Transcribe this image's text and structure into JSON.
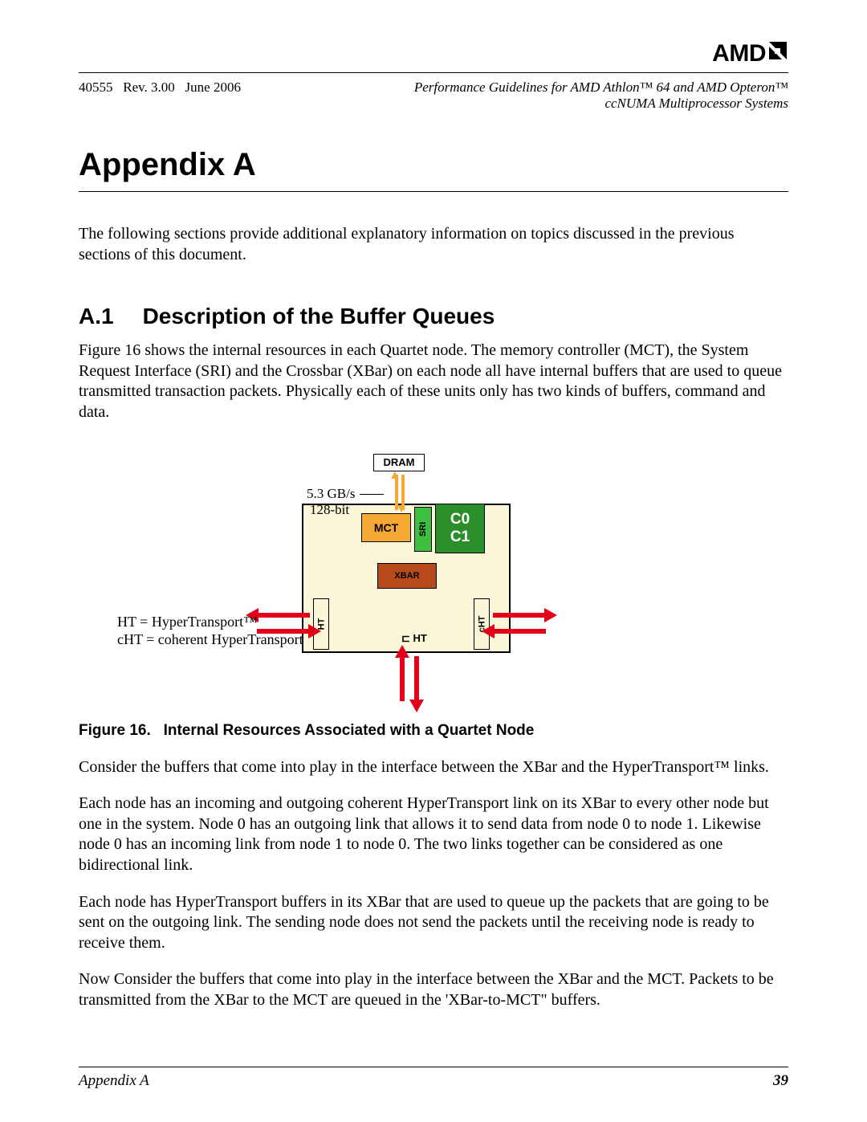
{
  "header": {
    "logo_text": "AMD",
    "doc_id": "40555",
    "rev": "Rev. 3.00",
    "date": "June 2006",
    "title_line1": "Performance Guidelines for AMD Athlon™ 64 and AMD Opteron™",
    "title_line2": "ccNUMA Multiprocessor Systems"
  },
  "appendix": {
    "title": "Appendix A",
    "intro": "The following sections provide additional explanatory information on topics discussed in the previous sections of this document."
  },
  "section": {
    "number": "A.1",
    "title": "Description of the Buffer Queues",
    "p1": "Figure 16 shows the internal resources in each Quartet node. The memory controller (MCT), the System Request Interface (SRI) and the Crossbar (XBar) on each node all have internal buffers that are used to queue transmitted transaction packets. Physically each of these units only has two kinds of buffers, command and data."
  },
  "figure": {
    "dram": "DRAM",
    "gbs": "5.3 GB/s",
    "bits": "128-bit",
    "mct": "MCT",
    "sri": "SRI",
    "c0": "C0",
    "c1": "C1",
    "xbar": "XBAR",
    "ht": "HT",
    "cht_short": "cHT",
    "cht_label": "⊏ HT",
    "legend_ht": "HT = HyperTransport™",
    "legend_cht": "cHT = coherent HyperTransport",
    "caption_prefix": "Figure 16.",
    "caption": "Internal Resources Associated with a Quartet Node"
  },
  "body": {
    "p2": "Consider the buffers that come into play in the interface between the XBar and the HyperTransport™ links.",
    "p3": "Each node has an incoming and outgoing coherent HyperTransport link on its XBar to every other node but one in the system. Node 0 has an outgoing link that allows it to send data from node 0 to node 1. Likewise node 0 has an incoming link from node 1 to node 0. The two links together can be considered as one bidirectional link.",
    "p4": "Each node has HyperTransport buffers in its XBar that are used to queue up the packets that are going to be sent on the outgoing link. The sending node does not send the packets until the receiving node is ready to receive them.",
    "p5": "Now Consider the buffers that come into play in the interface between the XBar and the MCT. Packets to be transmitted from the XBar to the MCT are queued in the 'XBar-to-MCT\" buffers."
  },
  "footer": {
    "left": "Appendix A",
    "page": "39"
  }
}
